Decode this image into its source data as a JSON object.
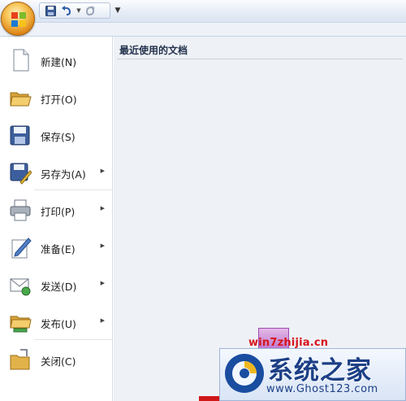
{
  "quick_access": {
    "save_icon": "floppy-disk-icon",
    "undo_icon": "undo-icon",
    "redo_icon": "redo-icon"
  },
  "menu": {
    "items": [
      {
        "label": "新建(N)",
        "icon": "new-document-icon",
        "submenu": false
      },
      {
        "label": "打开(O)",
        "icon": "open-folder-icon",
        "submenu": false
      },
      {
        "label": "保存(S)",
        "icon": "floppy-disk-icon",
        "submenu": false
      },
      {
        "label": "另存为(A)",
        "icon": "save-as-icon",
        "submenu": true
      },
      {
        "label": "打印(P)",
        "icon": "printer-icon",
        "submenu": true
      },
      {
        "label": "准备(E)",
        "icon": "prepare-pen-icon",
        "submenu": true
      },
      {
        "label": "发送(D)",
        "icon": "send-mail-icon",
        "submenu": true
      },
      {
        "label": "发布(U)",
        "icon": "publish-folder-icon",
        "submenu": true
      },
      {
        "label": "关闭(C)",
        "icon": "close-folder-icon",
        "submenu": false
      }
    ]
  },
  "recent": {
    "title": "最近使用的文档"
  },
  "watermark": {
    "site": "win7zhijia.cn",
    "name": "系统之家",
    "url": "www.Ghost123.com"
  },
  "colors": {
    "office_orange": "#e08a1a",
    "watermark_blue": "#1c3f86",
    "watermark_red": "#d8141b"
  }
}
